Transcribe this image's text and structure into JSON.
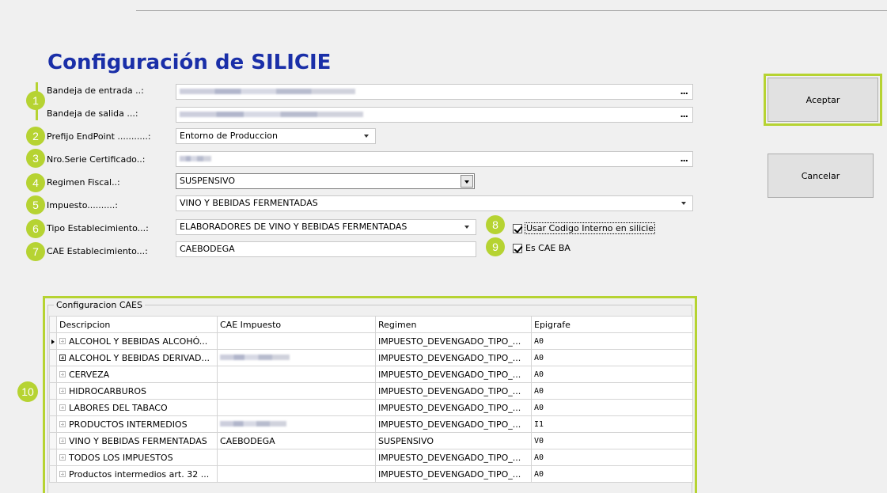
{
  "title": "Configuración de SILICIE",
  "form": {
    "bandeja_entrada_label": "Bandeja de entrada ..:",
    "bandeja_salida_label": "Bandeja de salida ...:",
    "prefijo_label": "Prefijo EndPoint ...........:",
    "prefijo_value": "Entorno de Produccion",
    "nro_serie_label": "Nro.Serie Certificado..:",
    "regimen_label": "Regimen Fiscal..:",
    "regimen_value": "SUSPENSIVO",
    "impuesto_label": "Impuesto..........:",
    "impuesto_value": "VINO Y BEBIDAS FERMENTADAS",
    "tipo_label": "Tipo Establecimiento...:",
    "tipo_value": "ELABORADORES DE VINO Y BEBIDAS FERMENTADAS",
    "cae_label": "CAE Establecimiento...:",
    "cae_value": "CAEBODEGA",
    "usar_codigo_label": "Usar Codigo Interno en silicie",
    "es_cae_ba_label": "Es CAE BA",
    "ellipsis": "..."
  },
  "buttons": {
    "aceptar": "Aceptar",
    "cancelar": "Cancelar"
  },
  "badges": [
    "1",
    "2",
    "3",
    "4",
    "5",
    "6",
    "7",
    "8",
    "9",
    "10"
  ],
  "group": {
    "legend": "Configuracion CAES",
    "columns": [
      "Descripcion",
      "CAE Impuesto",
      "Regimen",
      "Epigrafe"
    ],
    "rows": [
      {
        "descripcion": "ALCOHOL Y BEBIDAS ALCOHÓ...",
        "regimen": "IMPUESTO_DEVENGADO_TIPO_...",
        "epigrafe": "A0"
      },
      {
        "descripcion": "ALCOHOL Y BEBIDAS DERIVAD...",
        "regimen": "IMPUESTO_DEVENGADO_TIPO_...",
        "epigrafe": "A0"
      },
      {
        "descripcion": "CERVEZA",
        "regimen": "IMPUESTO_DEVENGADO_TIPO_...",
        "epigrafe": "A0"
      },
      {
        "descripcion": "HIDROCARBUROS",
        "regimen": "IMPUESTO_DEVENGADO_TIPO_...",
        "epigrafe": "A0"
      },
      {
        "descripcion": "LABORES DEL TABACO",
        "regimen": "IMPUESTO_DEVENGADO_TIPO_...",
        "epigrafe": "A0"
      },
      {
        "descripcion": "PRODUCTOS INTERMEDIOS",
        "regimen": "IMPUESTO_DEVENGADO_TIPO_...",
        "epigrafe": "I1"
      },
      {
        "descripcion": "VINO Y BEBIDAS FERMENTADAS",
        "cae": "CAEBODEGA",
        "regimen": "SUSPENSIVO",
        "epigrafe": "V0"
      },
      {
        "descripcion": "TODOS LOS IMPUESTOS",
        "regimen": "IMPUESTO_DEVENGADO_TIPO_...",
        "epigrafe": "A0"
      },
      {
        "descripcion": "Productos intermedios art. 32 ...",
        "regimen": "IMPUESTO_DEVENGADO_TIPO_...",
        "epigrafe": "A0"
      }
    ]
  },
  "colors": {
    "accent": "#b6d332",
    "title": "#1a2fa8"
  }
}
